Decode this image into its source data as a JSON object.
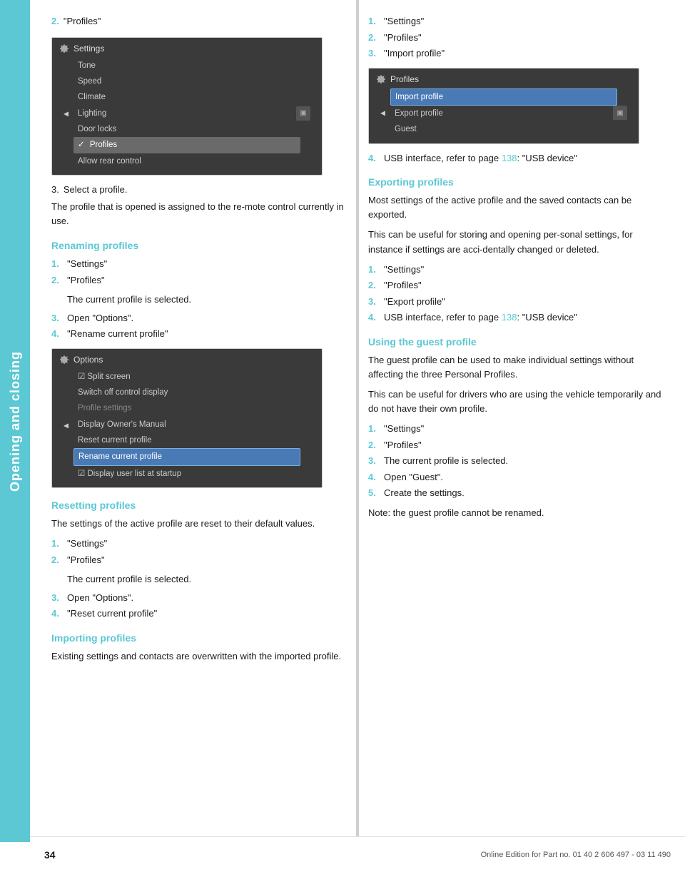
{
  "sideTab": {
    "text": "Opening and closing"
  },
  "leftCol": {
    "topEntry": {
      "num": "2.",
      "text": "\"Profiles\""
    },
    "screen1": {
      "title": "Settings",
      "menuItems": [
        {
          "label": "Tone",
          "selected": false
        },
        {
          "label": "Speed",
          "selected": false
        },
        {
          "label": "Climate",
          "selected": false
        },
        {
          "label": "Lighting",
          "selected": false
        },
        {
          "label": "Door locks",
          "selected": false
        },
        {
          "label": "✓ Profiles",
          "selected": true
        },
        {
          "label": "Allow rear control",
          "selected": false
        }
      ]
    },
    "step3": {
      "num": "3.",
      "text": "Select a profile."
    },
    "bodyText1": "The profile that is opened is assigned to the re‑mote control currently in use.",
    "renaming": {
      "heading": "Renaming profiles",
      "steps": [
        {
          "num": "1.",
          "text": "\"Settings\""
        },
        {
          "num": "2.",
          "text": "\"Profiles\""
        },
        {
          "num": "3.",
          "text": "Open \"Options\"."
        },
        {
          "num": "4.",
          "text": "\"Rename current profile\""
        }
      ],
      "indentText": "The current profile is selected."
    },
    "screen2": {
      "title": "Options",
      "menuItems": [
        {
          "label": "☑ Split screen",
          "selected": false
        },
        {
          "label": "Switch off control display",
          "selected": false
        },
        {
          "label": "Profile settings",
          "selected": false,
          "dim": true
        },
        {
          "label": "Display Owner's Manual",
          "selected": false
        },
        {
          "label": "Reset current profile",
          "selected": false
        },
        {
          "label": "Rename current profile",
          "selected": true
        },
        {
          "label": "☑ Display user list at startup",
          "selected": false
        }
      ]
    },
    "resetting": {
      "heading": "Resetting profiles",
      "bodyText": "The settings of the active profile are reset to their default values.",
      "steps": [
        {
          "num": "1.",
          "text": "\"Settings\""
        },
        {
          "num": "2.",
          "text": "\"Profiles\""
        },
        {
          "num": "3.",
          "text": "Open \"Options\"."
        },
        {
          "num": "4.",
          "text": "\"Reset current profile\""
        }
      ],
      "indentText": "The current profile is selected."
    },
    "importing": {
      "heading": "Importing profiles",
      "bodyText": "Existing settings and contacts are overwritten with the imported profile.",
      "steps": [
        {
          "num": "1.",
          "text": "\"Settings\""
        },
        {
          "num": "2.",
          "text": "\"Profiles\""
        },
        {
          "num": "3.",
          "text": "\"Import profile\""
        }
      ]
    }
  },
  "rightCol": {
    "importSteps": [
      {
        "num": "1.",
        "text": "\"Settings\""
      },
      {
        "num": "2.",
        "text": "\"Profiles\""
      },
      {
        "num": "3.",
        "text": "\"Import profile\""
      }
    ],
    "screen3": {
      "title": "Profiles",
      "menuItems": [
        {
          "label": "Import profile",
          "selected": true
        },
        {
          "label": "Export profile",
          "selected": false
        },
        {
          "label": "Guest",
          "selected": false
        }
      ]
    },
    "step4": {
      "num": "4.",
      "text": "USB interface, refer to page ",
      "pageNum": "138",
      "textSuffix": ": \"USB device\""
    },
    "exporting": {
      "heading": "Exporting profiles",
      "bodyText1": "Most settings of the active profile and the saved contacts can be exported.",
      "bodyText2": "This can be useful for storing and opening per‑sonal settings, for instance if settings are acci‑dentally changed or deleted.",
      "steps": [
        {
          "num": "1.",
          "text": "\"Settings\""
        },
        {
          "num": "2.",
          "text": "\"Profiles\""
        },
        {
          "num": "3.",
          "text": "\"Export profile\""
        }
      ],
      "step4": {
        "num": "4.",
        "text": "USB interface, refer to page ",
        "pageNum": "138",
        "textSuffix": ": \"USB device\""
      }
    },
    "guestProfile": {
      "heading": "Using the guest profile",
      "bodyText1": "The guest profile can be used to make individual settings without affecting the three Personal Profiles.",
      "bodyText2": "This can be useful for drivers who are using the vehicle temporarily and do not have their own profile.",
      "steps": [
        {
          "num": "1.",
          "text": "\"Settings\""
        },
        {
          "num": "2.",
          "text": "\"Profiles\""
        },
        {
          "num": "3.",
          "text": "The current profile is selected."
        },
        {
          "num": "4.",
          "text": "Open \"Guest\"."
        },
        {
          "num": "5.",
          "text": "Create the settings."
        }
      ],
      "noteText": "Note: the guest profile cannot be renamed."
    }
  },
  "footer": {
    "pageNum": "34",
    "text": "Online Edition for Part no. 01 40 2 606 497 - 03 11 490"
  }
}
